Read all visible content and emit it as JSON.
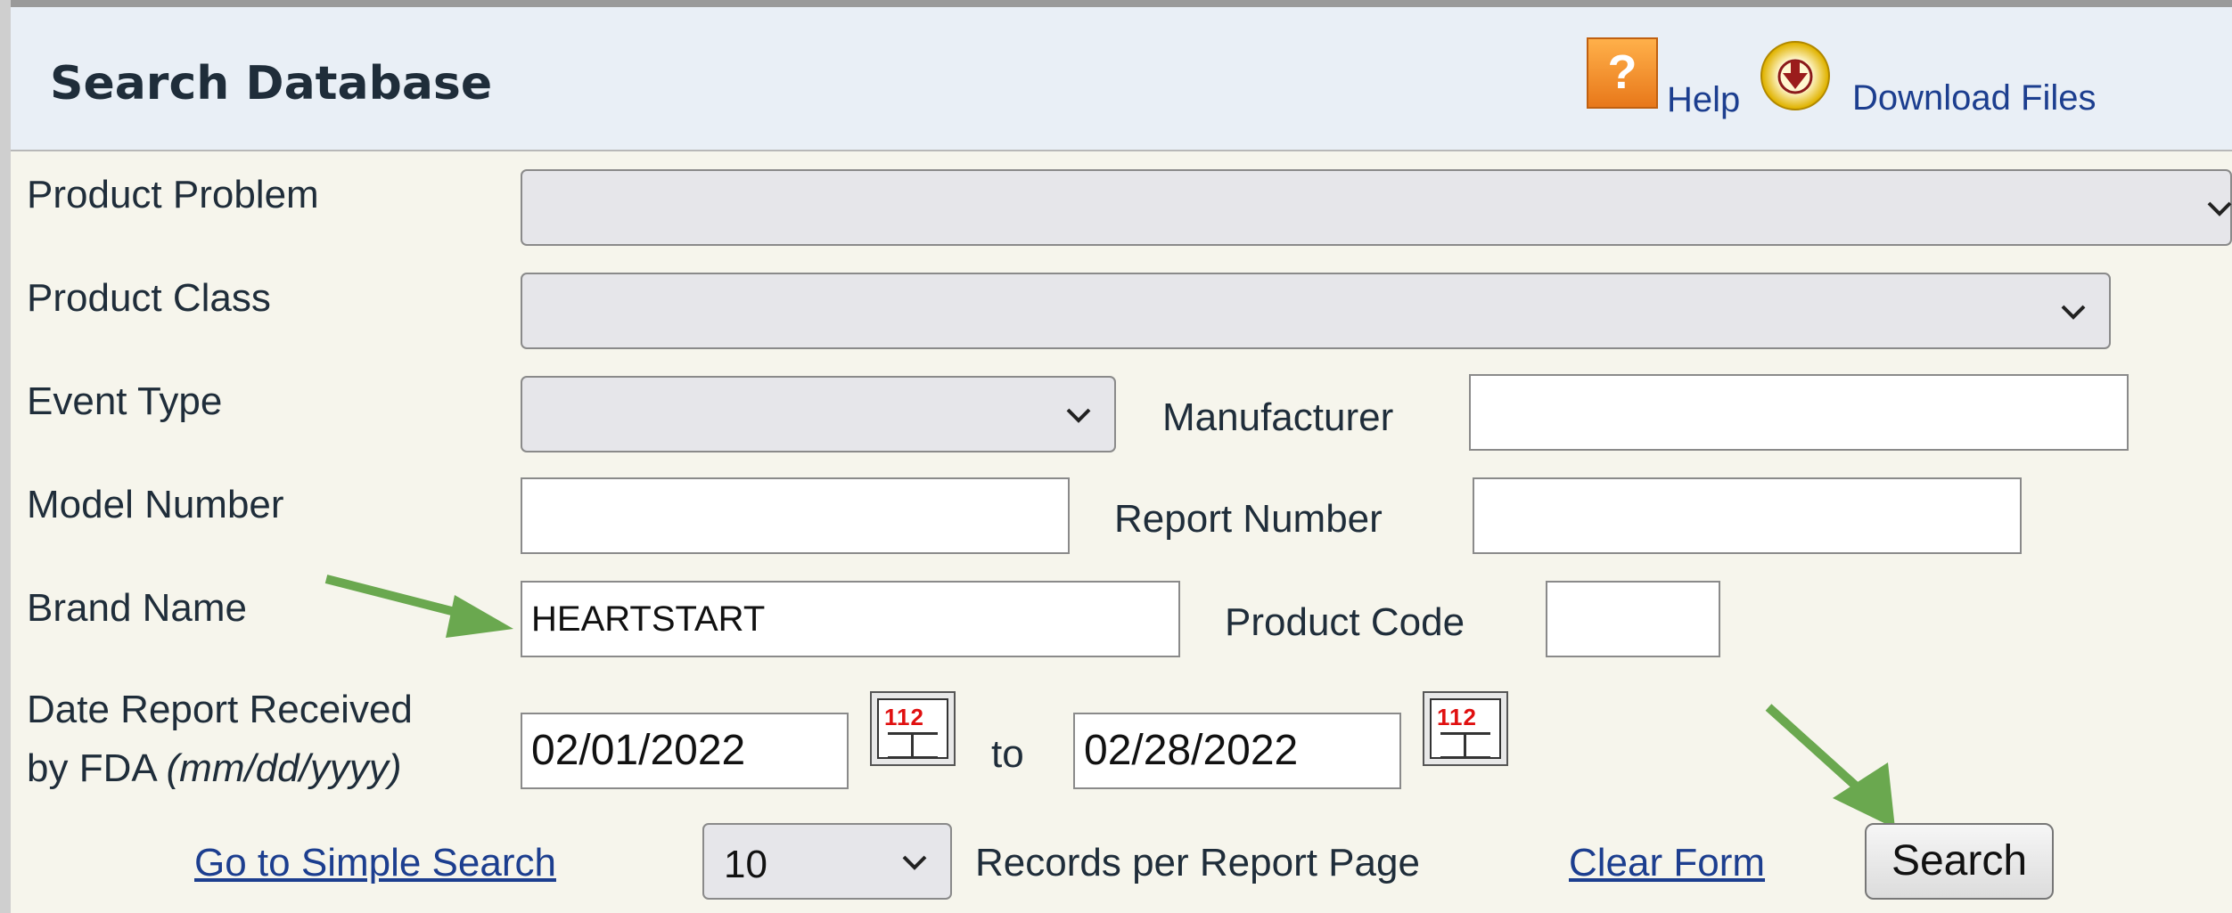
{
  "header": {
    "title": "Search Database",
    "help_label": "Help",
    "download_label": "Download Files"
  },
  "form": {
    "product_problem_label": "Product Problem",
    "product_class_label": "Product Class",
    "event_type_label": "Event Type",
    "manufacturer_label": "Manufacturer",
    "model_number_label": "Model Number",
    "report_number_label": "Report Number",
    "brand_name_label": "Brand Name",
    "brand_name_value": "HEARTSTART",
    "product_code_label": "Product Code",
    "date_label_line1": "Date Report Received",
    "date_label_line2": "by FDA",
    "date_format_hint": "(mm/dd/yyyy)",
    "date_from": "02/01/2022",
    "to_label": "to",
    "date_to": "02/28/2022",
    "calendar_icon_text": "112"
  },
  "footer": {
    "simple_search_link": "Go to Simple Search",
    "records_per_page_value": "10",
    "records_per_page_label": "Records per Report Page",
    "clear_form_link": "Clear Form",
    "search_button": "Search"
  },
  "colors": {
    "arrow": "#6aa84f",
    "link": "#1c3e8f",
    "header_bg": "#e9eff6"
  },
  "icons": [
    "help-icon",
    "download-icon",
    "calendar-icon",
    "chevron-down-icon",
    "arrow-icon"
  ]
}
